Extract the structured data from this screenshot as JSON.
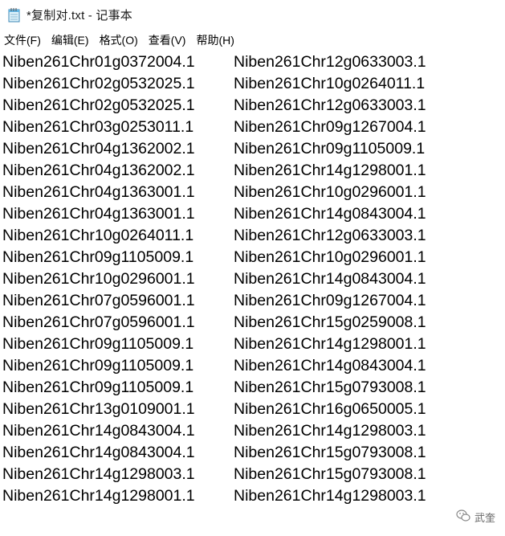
{
  "window": {
    "title": "*复制对.txt - 记事本"
  },
  "menu": [
    "文件(F)",
    "编辑(E)",
    "格式(O)",
    "查看(V)",
    "帮助(H)"
  ],
  "rows": [
    [
      "Niben261Chr01g0372004.1",
      "Niben261Chr12g0633003.1"
    ],
    [
      "Niben261Chr02g0532025.1",
      "Niben261Chr10g0264011.1"
    ],
    [
      "Niben261Chr02g0532025.1",
      "Niben261Chr12g0633003.1"
    ],
    [
      "Niben261Chr03g0253011.1",
      "Niben261Chr09g1267004.1"
    ],
    [
      "Niben261Chr04g1362002.1",
      "Niben261Chr09g1105009.1"
    ],
    [
      "Niben261Chr04g1362002.1",
      "Niben261Chr14g1298001.1"
    ],
    [
      "Niben261Chr04g1363001.1",
      "Niben261Chr10g0296001.1"
    ],
    [
      "Niben261Chr04g1363001.1",
      "Niben261Chr14g0843004.1"
    ],
    [
      "Niben261Chr10g0264011.1",
      "Niben261Chr12g0633003.1"
    ],
    [
      "Niben261Chr09g1105009.1",
      "Niben261Chr10g0296001.1"
    ],
    [
      "Niben261Chr10g0296001.1",
      "Niben261Chr14g0843004.1"
    ],
    [
      "Niben261Chr07g0596001.1",
      "Niben261Chr09g1267004.1"
    ],
    [
      "Niben261Chr07g0596001.1",
      "Niben261Chr15g0259008.1"
    ],
    [
      "Niben261Chr09g1105009.1",
      "Niben261Chr14g1298001.1"
    ],
    [
      "Niben261Chr09g1105009.1",
      "Niben261Chr14g0843004.1"
    ],
    [
      "Niben261Chr09g1105009.1",
      "Niben261Chr15g0793008.1"
    ],
    [
      "Niben261Chr13g0109001.1",
      "Niben261Chr16g0650005.1"
    ],
    [
      "Niben261Chr14g0843004.1",
      "Niben261Chr14g1298003.1"
    ],
    [
      "Niben261Chr14g0843004.1",
      "Niben261Chr15g0793008.1"
    ],
    [
      "Niben261Chr14g1298003.1",
      "Niben261Chr15g0793008.1"
    ],
    [
      "Niben261Chr14g1298001.1",
      "Niben261Chr14g1298003.1"
    ]
  ],
  "watermark": {
    "text": "武奎",
    "icon": "wechat-icon"
  }
}
